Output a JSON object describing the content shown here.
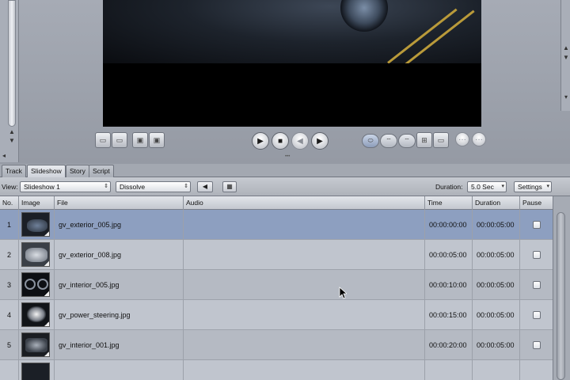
{
  "tabs": [
    {
      "label": "Track",
      "active": false
    },
    {
      "label": "Slideshow",
      "active": true
    },
    {
      "label": "Story",
      "active": false
    },
    {
      "label": "Script",
      "active": false
    }
  ],
  "toolbar": {
    "view_label": "View:",
    "slideshow_select": "Slideshow 1",
    "transition_select": "Dissolve",
    "duration_label": "Duration:",
    "duration_value": "5.0 Sec",
    "settings_label": "Settings"
  },
  "table": {
    "headers": {
      "no": "No.",
      "image": "Image",
      "file": "File",
      "audio": "Audio",
      "time": "Time",
      "duration": "Duration",
      "pause": "Pause"
    },
    "rows": [
      {
        "no": "1",
        "file": "gv_exterior_005.jpg",
        "audio": "",
        "time": "00:00:00:00",
        "duration": "00:00:05:00",
        "selected": true
      },
      {
        "no": "2",
        "file": "gv_exterior_008.jpg",
        "audio": "",
        "time": "00:00:05:00",
        "duration": "00:00:05:00",
        "selected": false
      },
      {
        "no": "3",
        "file": "gv_interior_005.jpg",
        "audio": "",
        "time": "00:00:10:00",
        "duration": "00:00:05:00",
        "selected": false
      },
      {
        "no": "4",
        "file": "gv_power_steering.jpg",
        "audio": "",
        "time": "00:00:15:00",
        "duration": "00:00:05:00",
        "selected": false
      },
      {
        "no": "5",
        "file": "gv_interior_001.jpg",
        "audio": "",
        "time": "00:00:20:00",
        "duration": "00:00:05:00",
        "selected": false
      }
    ]
  },
  "icons": {
    "play": "play-icon",
    "stop": "stop-icon",
    "prev": "step-back-icon",
    "next": "step-forward-icon"
  },
  "colors": {
    "selected_row": "#8d9fc0",
    "background": "#9ea3ad"
  }
}
